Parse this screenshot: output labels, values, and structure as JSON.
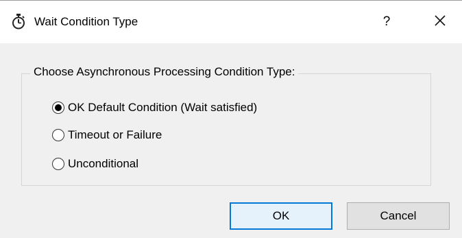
{
  "window": {
    "title": "Wait Condition Type",
    "icon": "stopwatch-icon",
    "help_label": "?",
    "close_icon": "close-icon"
  },
  "group": {
    "legend": "Choose Asynchronous Processing Condition Type:",
    "options": [
      {
        "label": "OK Default Condition (Wait satisfied)",
        "selected": true
      },
      {
        "label": "Timeout or Failure",
        "selected": false
      },
      {
        "label": "Unconditional",
        "selected": false
      }
    ]
  },
  "buttons": {
    "ok_label": "OK",
    "cancel_label": "Cancel"
  },
  "colors": {
    "dialog_bg": "#f0f0f0",
    "titlebar_bg": "#ffffff",
    "default_button_border": "#0078d7",
    "default_button_bg": "#e5f1fb"
  }
}
